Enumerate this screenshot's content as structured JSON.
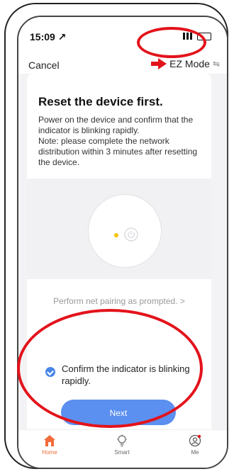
{
  "status": {
    "time": "15:09 ↗"
  },
  "nav": {
    "cancel": "Cancel",
    "mode": "EZ Mode",
    "switch_glyph": "⇋"
  },
  "content": {
    "title": "Reset the device first.",
    "description": "Power on the device and confirm that the indicator is blinking rapidly.\nNote: please complete the network distribution within 3 minutes after resetting the device.",
    "hint": "Perform net pairing as prompted. >",
    "confirm_text": "Confirm the indicator is blinking rapidly.",
    "next_label": "Next"
  },
  "tabs": [
    {
      "label": "Home",
      "icon": "home-icon",
      "active": true
    },
    {
      "label": "Smart",
      "icon": "smart-icon",
      "active": false
    },
    {
      "label": "Me",
      "icon": "me-icon",
      "active": false
    }
  ],
  "colors": {
    "accent": "#5b8ff0",
    "callout": "#e3131b",
    "home_active": "#f26b3a",
    "indicator": "#f5c400"
  }
}
